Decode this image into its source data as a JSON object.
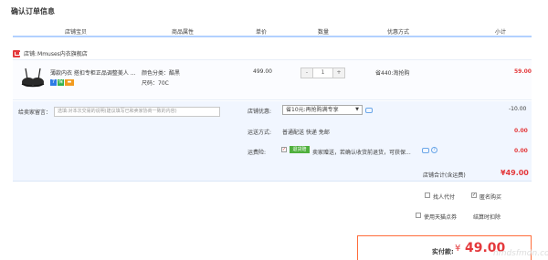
{
  "title": "确认订单信息",
  "columns": [
    "店铺宝贝",
    "商品属性",
    "单价",
    "数量",
    "优惠方式",
    "小计"
  ],
  "shop": {
    "label": "店铺:",
    "name": "Mmuses内衣旗舰店"
  },
  "item": {
    "name": "薄款内衣 搭扣专柜正品调整美人 ...",
    "attr_color": "颜色分类：酷黑",
    "attr_size": "尺码：70C",
    "price": "499.00",
    "quantity": "1",
    "minus": "-",
    "plus": "+",
    "discount": "省440:淘抢购",
    "subtotal": "59.00",
    "badge_colors": [
      "#2c7be5",
      "#32b24d",
      "#f29b1f"
    ]
  },
  "memo": {
    "label": "给卖家留言：",
    "placeholder": "选填:对本次交易的说明(建议填写已和卖家协商一致的内容)"
  },
  "shop_discount": {
    "label": "店铺优惠:",
    "selected": "省10元:再抢购满专享",
    "value": "-10.00"
  },
  "shipping": {
    "label": "运送方式:",
    "value": "普通配送 快递 免邮",
    "amount": "0.00"
  },
  "insurance": {
    "label": "运费险:",
    "tag": "退货赔",
    "text": "卖家赠送，若确认收货前退货，可获保...",
    "amount": "0.00"
  },
  "shop_total": {
    "label": "店铺合计(含运费)",
    "amount": "¥49.00"
  },
  "options": {
    "pay_for_me": "找人代付",
    "anonymous": "匿名购买",
    "tmall_points": "使用天猫点券",
    "settle_deduct": "结算时扣除"
  },
  "payment": {
    "label": "实付款:",
    "currency": "¥",
    "amount": "49.00"
  },
  "watermark": "nmdsfmdn.com"
}
